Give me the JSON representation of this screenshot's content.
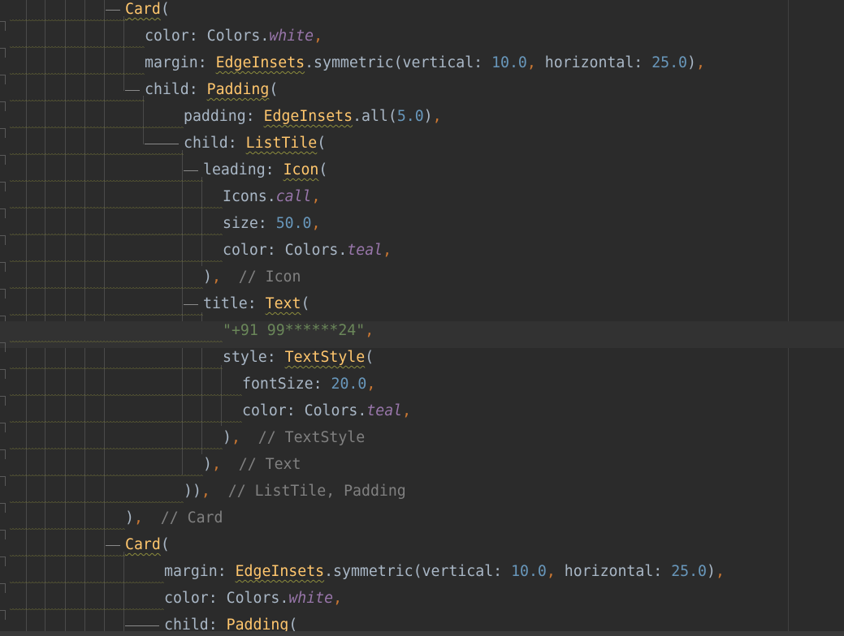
{
  "editor": {
    "language": "dart",
    "active_line_index": 12,
    "lines": [
      {
        "indent": 154,
        "tokens": [
          {
            "t": "Card",
            "c": "k"
          },
          {
            "t": "(",
            "c": "p"
          }
        ]
      },
      {
        "indent": 178,
        "tokens": [
          {
            "t": "color: ",
            "c": "p"
          },
          {
            "t": "Colors.",
            "c": "p"
          },
          {
            "t": "white",
            "c": "c"
          },
          {
            "t": ",",
            "c": "comma"
          }
        ]
      },
      {
        "indent": 178,
        "tokens": [
          {
            "t": "margin: ",
            "c": "p"
          },
          {
            "t": "EdgeInsets",
            "c": "k"
          },
          {
            "t": ".symmetric(vertical: ",
            "c": "p"
          },
          {
            "t": "10.0",
            "c": "n"
          },
          {
            "t": ", ",
            "c": "comma"
          },
          {
            "t": "horizontal: ",
            "c": "p"
          },
          {
            "t": "25.0",
            "c": "n"
          },
          {
            "t": ")",
            "c": "p"
          },
          {
            "t": ",",
            "c": "comma"
          }
        ]
      },
      {
        "indent": 178,
        "tokens": [
          {
            "t": "child: ",
            "c": "p"
          },
          {
            "t": "Padding",
            "c": "k"
          },
          {
            "t": "(",
            "c": "p"
          }
        ]
      },
      {
        "indent": 226,
        "tokens": [
          {
            "t": "padding: ",
            "c": "p"
          },
          {
            "t": "EdgeInsets",
            "c": "k"
          },
          {
            "t": ".all(",
            "c": "p"
          },
          {
            "t": "5.0",
            "c": "n"
          },
          {
            "t": ")",
            "c": "p"
          },
          {
            "t": ",",
            "c": "comma"
          }
        ]
      },
      {
        "indent": 226,
        "tokens": [
          {
            "t": "child: ",
            "c": "p"
          },
          {
            "t": "ListTile",
            "c": "k"
          },
          {
            "t": "(",
            "c": "p"
          }
        ]
      },
      {
        "indent": 250,
        "tokens": [
          {
            "t": "leading: ",
            "c": "p"
          },
          {
            "t": "Icon",
            "c": "k"
          },
          {
            "t": "(",
            "c": "p"
          }
        ]
      },
      {
        "indent": 274,
        "tokens": [
          {
            "t": "Icons.",
            "c": "p"
          },
          {
            "t": "call",
            "c": "c"
          },
          {
            "t": ",",
            "c": "comma"
          }
        ]
      },
      {
        "indent": 274,
        "tokens": [
          {
            "t": "size: ",
            "c": "p"
          },
          {
            "t": "50.0",
            "c": "n"
          },
          {
            "t": ",",
            "c": "comma"
          }
        ]
      },
      {
        "indent": 274,
        "tokens": [
          {
            "t": "color: ",
            "c": "p"
          },
          {
            "t": "Colors.",
            "c": "p"
          },
          {
            "t": "teal",
            "c": "c"
          },
          {
            "t": ",",
            "c": "comma"
          }
        ]
      },
      {
        "indent": 250,
        "tokens": [
          {
            "t": ")",
            "c": "p"
          },
          {
            "t": ",",
            "c": "comma"
          },
          {
            "t": "  // Icon",
            "c": "cm"
          }
        ]
      },
      {
        "indent": 250,
        "tokens": [
          {
            "t": "title: ",
            "c": "p"
          },
          {
            "t": "Text",
            "c": "k"
          },
          {
            "t": "(",
            "c": "p"
          }
        ]
      },
      {
        "indent": 274,
        "tokens": [
          {
            "t": "\"+91 99******24\"",
            "c": "s"
          },
          {
            "t": ",",
            "c": "comma"
          }
        ]
      },
      {
        "indent": 274,
        "tokens": [
          {
            "t": "style: ",
            "c": "p"
          },
          {
            "t": "TextStyle",
            "c": "k"
          },
          {
            "t": "(",
            "c": "p"
          }
        ]
      },
      {
        "indent": 298,
        "tokens": [
          {
            "t": "fontSize: ",
            "c": "p"
          },
          {
            "t": "20.0",
            "c": "n"
          },
          {
            "t": ",",
            "c": "comma"
          }
        ]
      },
      {
        "indent": 298,
        "tokens": [
          {
            "t": "color: ",
            "c": "p"
          },
          {
            "t": "Colors.",
            "c": "p"
          },
          {
            "t": "teal",
            "c": "c"
          },
          {
            "t": ",",
            "c": "comma"
          }
        ]
      },
      {
        "indent": 274,
        "tokens": [
          {
            "t": ")",
            "c": "p"
          },
          {
            "t": ",",
            "c": "comma"
          },
          {
            "t": "  // TextStyle",
            "c": "cm"
          }
        ]
      },
      {
        "indent": 250,
        "tokens": [
          {
            "t": ")",
            "c": "p"
          },
          {
            "t": ",",
            "c": "comma"
          },
          {
            "t": "  // Text",
            "c": "cm"
          }
        ]
      },
      {
        "indent": 226,
        "tokens": [
          {
            "t": "))",
            "c": "p"
          },
          {
            "t": ",",
            "c": "comma"
          },
          {
            "t": "  // ListTile, Padding",
            "c": "cm"
          }
        ]
      },
      {
        "indent": 154,
        "tokens": [
          {
            "t": ")",
            "c": "p"
          },
          {
            "t": ",",
            "c": "comma"
          },
          {
            "t": "  // Card",
            "c": "cm"
          }
        ]
      },
      {
        "indent": 154,
        "tokens": [
          {
            "t": "Card",
            "c": "k"
          },
          {
            "t": "(",
            "c": "p"
          }
        ]
      },
      {
        "indent": 202,
        "tokens": [
          {
            "t": "margin: ",
            "c": "p"
          },
          {
            "t": "EdgeInsets",
            "c": "k"
          },
          {
            "t": ".symmetric(vertical: ",
            "c": "p"
          },
          {
            "t": "10.0",
            "c": "n"
          },
          {
            "t": ", ",
            "c": "comma"
          },
          {
            "t": "horizontal: ",
            "c": "p"
          },
          {
            "t": "25.0",
            "c": "n"
          },
          {
            "t": ")",
            "c": "p"
          },
          {
            "t": ",",
            "c": "comma"
          }
        ]
      },
      {
        "indent": 202,
        "tokens": [
          {
            "t": "color: ",
            "c": "p"
          },
          {
            "t": "Colors.",
            "c": "p"
          },
          {
            "t": "white",
            "c": "c"
          },
          {
            "t": ",",
            "c": "comma"
          }
        ]
      },
      {
        "indent": 202,
        "tokens": [
          {
            "t": "child: ",
            "c": "p"
          },
          {
            "t": "Padding",
            "c": "k"
          },
          {
            "t": "(",
            "c": "p"
          }
        ]
      }
    ]
  }
}
